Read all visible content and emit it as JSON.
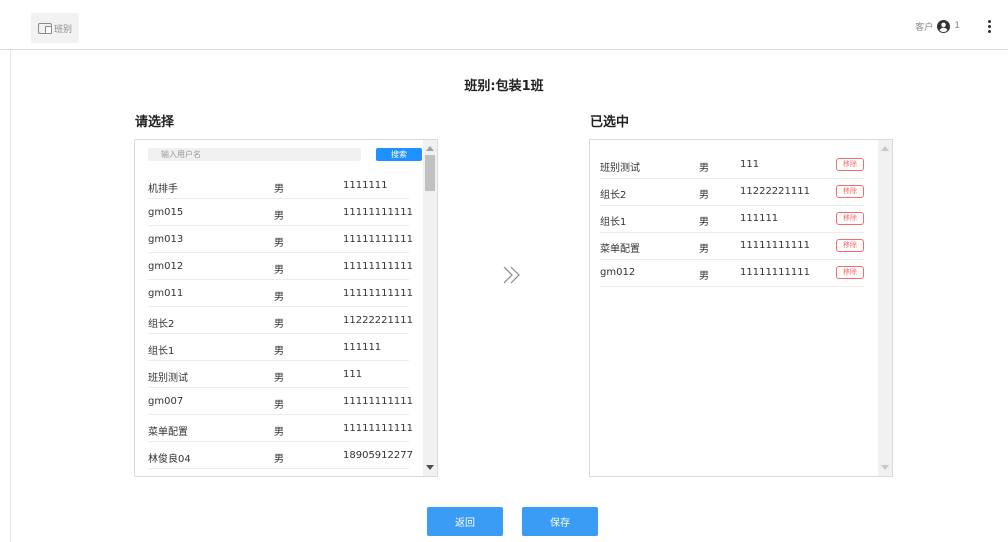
{
  "header": {
    "logo_text": "班别",
    "user_label": "客户",
    "user_name": "1"
  },
  "page_title": "班别:包装1班",
  "available": {
    "heading": "请选择",
    "search_placeholder": "输入用户名",
    "search_button": "搜索",
    "rows": [
      {
        "name": "机排手",
        "sex": "男",
        "phone": "1111111"
      },
      {
        "name": "gm015",
        "sex": "男",
        "phone": "11111111111"
      },
      {
        "name": "gm013",
        "sex": "男",
        "phone": "11111111111"
      },
      {
        "name": "gm012",
        "sex": "男",
        "phone": "11111111111"
      },
      {
        "name": "gm011",
        "sex": "男",
        "phone": "11111111111"
      },
      {
        "name": "组长2",
        "sex": "男",
        "phone": "11222221111"
      },
      {
        "name": "组长1",
        "sex": "男",
        "phone": "111111"
      },
      {
        "name": "班别测试",
        "sex": "男",
        "phone": "111"
      },
      {
        "name": "gm007",
        "sex": "男",
        "phone": "11111111111"
      },
      {
        "name": "菜单配置",
        "sex": "男",
        "phone": "11111111111"
      },
      {
        "name": "林俊良04",
        "sex": "男",
        "phone": "18905912277"
      }
    ]
  },
  "selected": {
    "heading": "已选中",
    "remove_label": "移除",
    "rows": [
      {
        "name": "班别测试",
        "sex": "男",
        "phone": "111"
      },
      {
        "name": "组长2",
        "sex": "男",
        "phone": "11222221111"
      },
      {
        "name": "组长1",
        "sex": "男",
        "phone": "111111"
      },
      {
        "name": "菜单配置",
        "sex": "男",
        "phone": "11111111111"
      },
      {
        "name": "gm012",
        "sex": "男",
        "phone": "11111111111"
      }
    ]
  },
  "footer": {
    "back_label": "返回",
    "save_label": "保存"
  },
  "icons": {
    "logo": "class-icon",
    "avatar": "user-circle-icon",
    "more": "more-vertical-icon",
    "transfer": "double-chevron-right-icon"
  },
  "colors": {
    "primary": "#3a9cf5",
    "search_button": "#1e90ff",
    "remove": "#f56c6c"
  }
}
